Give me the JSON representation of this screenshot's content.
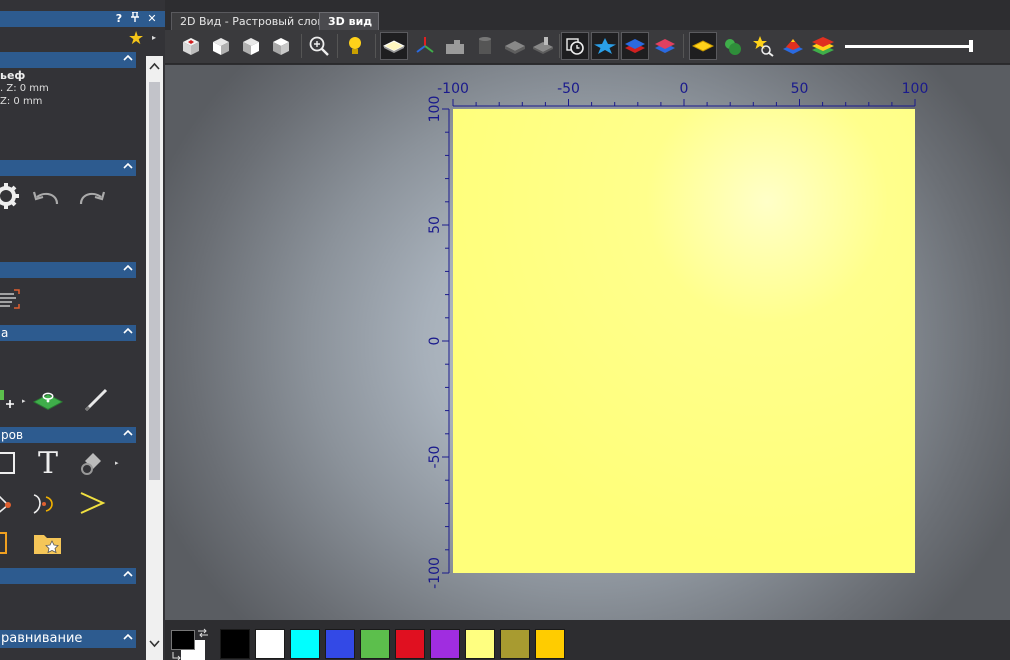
{
  "panel": {
    "titlebar": {
      "help": "?",
      "pin": "↑",
      "close": "✕"
    },
    "star_arrow": "▸",
    "sections": [
      {
        "label": "",
        "chevron": "⌃"
      },
      {
        "label": "",
        "chevron": "⌃"
      },
      {
        "label": "",
        "chevron": "⌃"
      },
      {
        "label": "а",
        "chevron": "⌃"
      },
      {
        "label": "ров",
        "chevron": "⌃"
      },
      {
        "label": "",
        "chevron": "⌃"
      },
      {
        "label": "равнивание",
        "chevron": "⌃"
      }
    ],
    "info": {
      "title": "ьеф",
      "line1": ". Z: 0 mm",
      "line2": "Z: 0 mm"
    },
    "text_tool_glyph": "T",
    "scroll": {
      "up": "⌃",
      "down": "⌄"
    }
  },
  "tabs": [
    {
      "label": "2D Вид - Растровый слой",
      "active": false
    },
    {
      "label": "3D вид",
      "active": true
    }
  ],
  "toolbar": {
    "icons": [
      "view-iso-cube-icon",
      "view-front-cube-icon",
      "view-side-cube-icon",
      "view-top-cube-icon",
      "zoom-icon",
      "light-icon",
      "shaded-layer-icon",
      "axes-icon",
      "machine-part-icon",
      "cylinder-icon",
      "gray-block-icon",
      "tool-block-icon",
      "timer-icon",
      "blue-star-icon",
      "blue-layers-icon",
      "red-layers-icon",
      "yellow-layer-icon",
      "green-shapes-icon",
      "star-search-icon",
      "pyramid-icon",
      "rainbow-layers-icon"
    ],
    "slider_value": 1.0
  },
  "chart_data": {
    "type": "area",
    "title": "",
    "x_ticks": [
      -100,
      -50,
      0,
      50,
      100
    ],
    "y_ticks": [
      100,
      50,
      0,
      -50,
      -100
    ],
    "xlim": [
      -100,
      100
    ],
    "ylim": [
      -100,
      100
    ],
    "fill_color": "#ffff7a",
    "axis_color": "#1a1a8c",
    "grid": false
  },
  "palette": {
    "foreground": "#000000",
    "background": "#ffffff",
    "swatches": [
      "#000000",
      "#ffffff",
      "#00ffff",
      "#3349e6",
      "#5cbf4c",
      "#e01020",
      "#a02de0",
      "#ffff80",
      "#a89b30",
      "#ffcc00"
    ]
  }
}
